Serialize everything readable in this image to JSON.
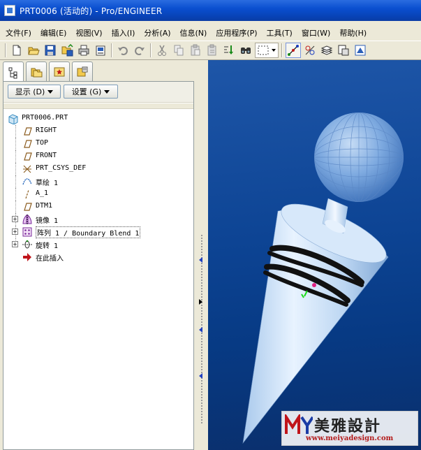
{
  "window": {
    "title": "PRT0006 (活动的) - Pro/ENGINEER"
  },
  "menu": {
    "items": [
      "文件(F)",
      "编辑(E)",
      "视图(V)",
      "插入(I)",
      "分析(A)",
      "信息(N)",
      "应用程序(P)",
      "工具(T)",
      "窗口(W)",
      "帮助(H)"
    ]
  },
  "toolbar": {
    "buttons": [
      "new-icon",
      "open-icon",
      "save-icon",
      "save-copy-icon",
      "print-icon",
      "print-setup-icon",
      "undo-icon",
      "redo-icon",
      "cut-icon",
      "copy-icon",
      "paste-icon",
      "paste-special-icon",
      "regenerate-icon",
      "find-icon",
      "selection-box-icon",
      "datum-axis-icon",
      "datum-point-icon",
      "layers-icon",
      "view-manager-icon",
      "display-style-icon"
    ]
  },
  "navigator": {
    "tabs": [
      "model-tree-icon",
      "folder-browser-icon",
      "favorites-icon",
      "connections-icon"
    ],
    "show_label": "显示 (D)",
    "settings_label": "设置 (G)"
  },
  "tree": {
    "root": "PRT0006.PRT",
    "items": [
      {
        "label": "RIGHT",
        "icon": "datum-plane-icon",
        "expandable": false
      },
      {
        "label": "TOP",
        "icon": "datum-plane-icon",
        "expandable": false
      },
      {
        "label": "FRONT",
        "icon": "datum-plane-icon",
        "expandable": false
      },
      {
        "label": "PRT_CSYS_DEF",
        "icon": "coordinate-system-icon",
        "expandable": false
      },
      {
        "label": "草绘 1",
        "icon": "sketch-icon",
        "expandable": false
      },
      {
        "label": "A_1",
        "icon": "datum-axis-icon",
        "expandable": false
      },
      {
        "label": "DTM1",
        "icon": "datum-plane-icon",
        "expandable": false
      },
      {
        "label": "镜像 1",
        "icon": "mirror-icon",
        "expandable": true
      },
      {
        "label": "阵列 1 / Boundary Blend 1",
        "icon": "pattern-icon",
        "expandable": true
      },
      {
        "label": "旋转 1",
        "icon": "revolve-icon",
        "expandable": true
      },
      {
        "label": "在此插入",
        "icon": "insert-here-arrow-icon",
        "expandable": false
      }
    ]
  },
  "graphics": {
    "model": "bottle-stopper-model"
  },
  "watermark": {
    "brand": "美雅設計",
    "url": "www.meiyadesign.com"
  }
}
